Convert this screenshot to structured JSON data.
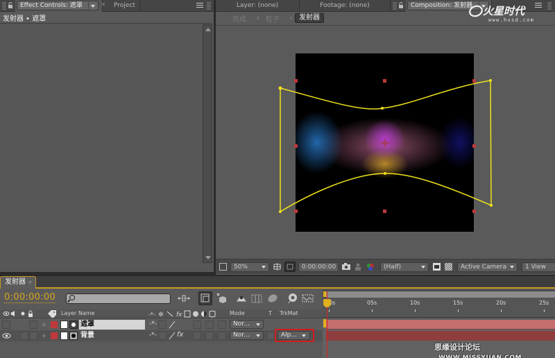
{
  "effect_controls": {
    "tab_label": "Effect Controls: 遮罩",
    "other_tab": "Project",
    "breadcrumb": "发射器 • 遮罩"
  },
  "composition": {
    "tabs": [
      "Layer: (none)",
      "Footage: (none)"
    ],
    "active_tab": "Composition: 发射器",
    "crumbs": [
      "完成",
      "粒子",
      "发射器"
    ],
    "toolbar": {
      "zoom": "50%",
      "timecode": "0:00:00:00",
      "resolution": "(Half)",
      "camera": "Active Camera",
      "view": "1 View"
    }
  },
  "logo": {
    "text": "火星时代",
    "url": "www.hxsd.com"
  },
  "timeline": {
    "tab_label": "发射器",
    "timecode": "0:00:00:00",
    "search_placeholder": "",
    "columns": {
      "layer_name": "Layer Name",
      "mode": "Mode",
      "t": "T",
      "trkmat": "TrkMat"
    },
    "layers": [
      {
        "name": "遮罩",
        "mode": "Nor...",
        "trkmat": "",
        "label_color": "#c0393a",
        "visible": false,
        "selected": true
      },
      {
        "name": "背景",
        "mode": "Nor...",
        "trkmat": "Alp...",
        "label_color": "#c0393a",
        "visible": true,
        "selected": false
      }
    ],
    "ruler_ticks": [
      "00s",
      "05s",
      "10s",
      "15s",
      "20s",
      "25s"
    ],
    "current_time": "0:00:00:00"
  },
  "watermark": {
    "text": "思缘设计论坛",
    "url": "WWW.MISSYUAN.COM"
  },
  "colors": {
    "accent": "#d9a51d",
    "mask_path": "#f0e21c",
    "highlight": "#d41b1b",
    "layer_bar_1": "#c46e6e",
    "layer_bar_2": "#8e3e3e"
  }
}
